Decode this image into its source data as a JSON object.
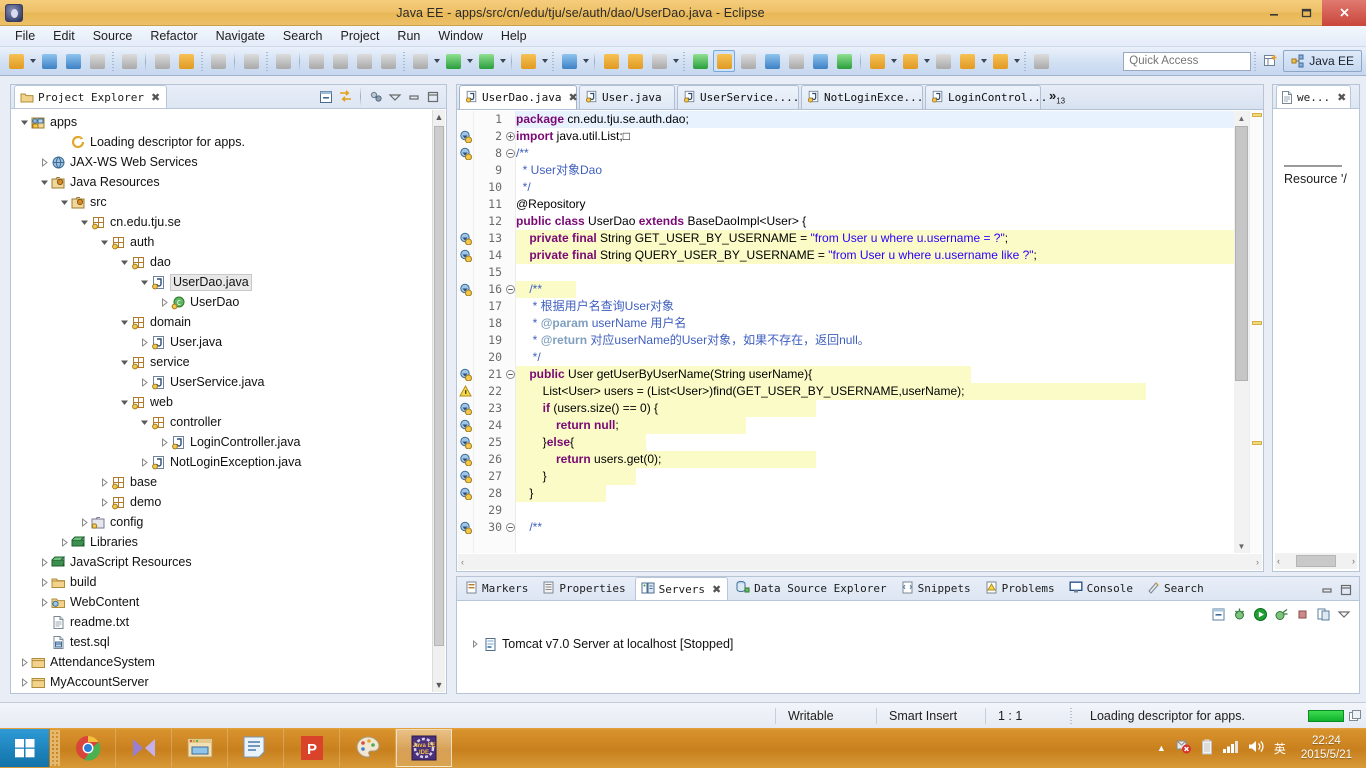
{
  "window": {
    "title": "Java EE - apps/src/cn/edu/tju/se/auth/dao/UserDao.java - Eclipse",
    "app_icon": "eclipse-icon",
    "minimize_label": "–",
    "maximize_label": "❐",
    "close_label": "✕"
  },
  "menubar": {
    "items": [
      "File",
      "Edit",
      "Source",
      "Refactor",
      "Navigate",
      "Search",
      "Project",
      "Run",
      "Window",
      "Help"
    ]
  },
  "toolbar": {
    "groups": [
      {
        "items": [
          {
            "icon": "new-wizard-icon",
            "color": "sq-orange",
            "dropdown": true
          },
          {
            "icon": "save-icon",
            "color": "sq-blue",
            "dropdown": false
          },
          {
            "icon": "save-all-icon",
            "color": "sq-blue",
            "dropdown": false
          },
          {
            "icon": "print-icon",
            "color": "sq-gray",
            "dropdown": false
          }
        ]
      },
      {
        "items": [
          {
            "icon": "toggle-mark-occurrences-icon",
            "color": "sq-gray",
            "dropdown": false
          }
        ]
      },
      {
        "items": [
          {
            "icon": "build-all-icon",
            "color": "sq-gray",
            "dropdown": false
          },
          {
            "icon": "build-project-icon",
            "color": "sq-orange",
            "dropdown": false
          }
        ]
      },
      {
        "items": [
          {
            "icon": "new-java-package-icon",
            "color": "sq-gray",
            "dropdown": false
          }
        ]
      },
      {
        "items": [
          {
            "icon": "undo-icon",
            "color": "sq-gray",
            "dropdown": false
          }
        ]
      },
      {
        "items": [
          {
            "icon": "redo-icon",
            "color": "sq-gray",
            "dropdown": false
          }
        ]
      },
      {
        "items": [
          {
            "icon": "step-into-icon",
            "color": "sq-gray",
            "dropdown": false
          },
          {
            "icon": "suspend-icon",
            "color": "sq-gray",
            "dropdown": false
          },
          {
            "icon": "terminate-icon",
            "color": "sq-gray",
            "dropdown": false
          },
          {
            "icon": "disconnect-icon",
            "color": "sq-gray",
            "dropdown": false
          }
        ]
      },
      {
        "items": [
          {
            "icon": "debug-icon",
            "color": "sq-gray",
            "dropdown": true
          },
          {
            "icon": "run-icon",
            "color": "sq-green",
            "dropdown": true
          },
          {
            "icon": "run-on-server-icon",
            "color": "sq-green",
            "dropdown": true
          }
        ]
      },
      {
        "items": [
          {
            "icon": "new-java-class-icon",
            "color": "sq-orange",
            "dropdown": true
          }
        ]
      },
      {
        "items": [
          {
            "icon": "new-spring-bean-icon",
            "color": "sq-blue",
            "dropdown": true
          }
        ]
      },
      {
        "items": [
          {
            "icon": "open-type-icon",
            "color": "sq-orange",
            "dropdown": false
          },
          {
            "icon": "open-task-icon",
            "color": "sq-orange",
            "dropdown": false
          },
          {
            "icon": "search-icon",
            "color": "sq-gray",
            "dropdown": true
          }
        ]
      },
      {
        "items": [
          {
            "icon": "previous-annotation-icon",
            "color": "sq-green",
            "dropdown": false
          },
          {
            "icon": "toggle-highlight-icon",
            "color": "sq-orange",
            "dropdown": false,
            "active": true
          },
          {
            "icon": "next-annotation-icon",
            "color": "sq-gray",
            "dropdown": false
          },
          {
            "icon": "block-selection-icon",
            "color": "sq-blue",
            "dropdown": false
          },
          {
            "icon": "show-whitespace-icon",
            "color": "sq-gray",
            "dropdown": false
          },
          {
            "icon": "open-web-browser-icon",
            "color": "sq-blue",
            "dropdown": false
          },
          {
            "icon": "external-tools-icon",
            "color": "sq-green",
            "dropdown": false
          }
        ]
      },
      {
        "items": [
          {
            "icon": "previous-edit-location-icon",
            "color": "sq-orange",
            "dropdown": true
          },
          {
            "icon": "next-edit-location-icon",
            "color": "sq-orange",
            "dropdown": true
          },
          {
            "icon": "back-icon",
            "color": "sq-gray",
            "dropdown": false
          },
          {
            "icon": "forward-history-icon",
            "color": "sq-orange",
            "dropdown": true
          },
          {
            "icon": "forward-icon",
            "color": "sq-orange",
            "dropdown": true
          }
        ]
      },
      {
        "items": [
          {
            "icon": "pin-editor-icon",
            "color": "sq-gray",
            "dropdown": false
          }
        ]
      }
    ],
    "quick_access_placeholder": "Quick Access",
    "new-perspective-icon": "open-perspective-icon",
    "perspective_label": "Java EE"
  },
  "project_explorer": {
    "tab_label": "Project Explorer",
    "tab_close": "✖",
    "tools": [
      "collapse-all-icon",
      "link-with-editor-icon",
      "view-menu-icon",
      "minimize-icon",
      "maximize-icon"
    ],
    "tree": [
      {
        "depth": 0,
        "twist": "open",
        "icon": "project-icon",
        "label": "apps"
      },
      {
        "depth": 2,
        "twist": "none",
        "icon": "loading-icon",
        "label": "Loading descriptor for apps."
      },
      {
        "depth": 1,
        "twist": "closed",
        "icon": "jaxws-icon",
        "label": "JAX-WS Web Services"
      },
      {
        "depth": 1,
        "twist": "open",
        "icon": "java-resources-icon",
        "label": "Java Resources"
      },
      {
        "depth": 2,
        "twist": "open",
        "icon": "source-folder-icon",
        "label": "src"
      },
      {
        "depth": 3,
        "twist": "open",
        "icon": "package-icon",
        "label": "cn.edu.tju.se"
      },
      {
        "depth": 4,
        "twist": "open",
        "icon": "package-icon",
        "label": "auth"
      },
      {
        "depth": 5,
        "twist": "open",
        "icon": "package-icon",
        "label": "dao"
      },
      {
        "depth": 6,
        "twist": "open",
        "icon": "java-file-icon",
        "label": "UserDao.java",
        "selected": true
      },
      {
        "depth": 7,
        "twist": "closed",
        "icon": "class-icon",
        "label": "UserDao"
      },
      {
        "depth": 5,
        "twist": "open",
        "icon": "package-icon",
        "label": "domain"
      },
      {
        "depth": 6,
        "twist": "closed",
        "icon": "java-file-icon",
        "label": "User.java"
      },
      {
        "depth": 5,
        "twist": "open",
        "icon": "package-icon",
        "label": "service"
      },
      {
        "depth": 6,
        "twist": "closed",
        "icon": "java-file-icon",
        "label": "UserService.java"
      },
      {
        "depth": 5,
        "twist": "open",
        "icon": "package-icon",
        "label": "web"
      },
      {
        "depth": 6,
        "twist": "open",
        "icon": "package-icon",
        "label": "controller"
      },
      {
        "depth": 7,
        "twist": "closed",
        "icon": "java-file-icon",
        "label": "LoginController.java"
      },
      {
        "depth": 6,
        "twist": "closed",
        "icon": "java-file-icon",
        "label": "NotLoginException.java"
      },
      {
        "depth": 4,
        "twist": "closed",
        "icon": "package-icon",
        "label": "base"
      },
      {
        "depth": 4,
        "twist": "closed",
        "icon": "package-icon",
        "label": "demo"
      },
      {
        "depth": 3,
        "twist": "closed",
        "icon": "config-folder-icon",
        "label": "config"
      },
      {
        "depth": 2,
        "twist": "closed",
        "icon": "library-icon",
        "label": "Libraries"
      },
      {
        "depth": 1,
        "twist": "closed",
        "icon": "library-icon",
        "label": "JavaScript Resources"
      },
      {
        "depth": 1,
        "twist": "closed",
        "icon": "folder-icon",
        "label": "build"
      },
      {
        "depth": 1,
        "twist": "closed",
        "icon": "webcontent-folder-icon",
        "label": "WebContent"
      },
      {
        "depth": 1,
        "twist": "none",
        "icon": "text-file-icon",
        "label": "readme.txt"
      },
      {
        "depth": 1,
        "twist": "none",
        "icon": "sql-file-icon",
        "label": "test.sql"
      },
      {
        "depth": 0,
        "twist": "closed",
        "icon": "closed-project-icon",
        "label": "AttendanceSystem"
      },
      {
        "depth": 0,
        "twist": "closed",
        "icon": "closed-project-icon",
        "label": "MyAccountServer"
      }
    ]
  },
  "editor": {
    "tabs": [
      {
        "label": "UserDao.java",
        "active": true,
        "close": "✖"
      },
      {
        "label": "User.java",
        "active": false
      },
      {
        "label": "UserService....",
        "active": false
      },
      {
        "label": "NotLoginExce...",
        "active": false
      },
      {
        "label": "LoginControl...",
        "active": false
      }
    ],
    "overflow_label": "»",
    "overflow_count": "13",
    "lines": [
      {
        "num": "1",
        "fold": "",
        "marker": "",
        "cur": true,
        "html": "<span class='kw'>package</span> cn.edu.tju.se.auth.dao;"
      },
      {
        "num": "2",
        "fold": "+",
        "marker": "warn",
        "html": "<span class='kw'>import</span> java.util.List;□"
      },
      {
        "num": "8",
        "fold": "-",
        "marker": "warn",
        "html": "<span class='jdoc'>/**</span>"
      },
      {
        "num": "9",
        "fold": "",
        "marker": "",
        "html": "  <span class='jdoc'>* User对象Dao</span>"
      },
      {
        "num": "10",
        "fold": "",
        "marker": "",
        "html": "  <span class='jdoc'>*/</span>"
      },
      {
        "num": "11",
        "fold": "",
        "marker": "",
        "html": "@Repository"
      },
      {
        "num": "12",
        "fold": "",
        "marker": "",
        "html": "<span class='kw'>public</span> <span class='kw'>class</span> UserDao <span class='kw'>extends</span> BaseDaoImpl&lt;User&gt; {"
      },
      {
        "num": "13",
        "fold": "",
        "marker": "warn",
        "hl": true,
        "html": "    <span class='kw'>private</span> <span class='kw'>final</span> String GET_USER_BY_USERNAME = <span class='str'>\"from User u where u.username = ?\"</span>;"
      },
      {
        "num": "14",
        "fold": "",
        "marker": "warn",
        "hl": true,
        "html": "    <span class='kw'>private</span> <span class='kw'>final</span> String QUERY_USER_BY_USERNAME = <span class='str'>\"from User u where u.username like ?\"</span>;"
      },
      {
        "num": "15",
        "fold": "",
        "marker": "",
        "html": ""
      },
      {
        "num": "16",
        "fold": "-",
        "marker": "warn",
        "hl": true,
        "hlw": "60",
        "html": "    <span class='jdoc'>/**</span>"
      },
      {
        "num": "17",
        "fold": "",
        "marker": "",
        "html": "     <span class='jdoc'>* 根据用户名查询User对象</span>"
      },
      {
        "num": "18",
        "fold": "",
        "marker": "",
        "html": "     <span class='jdoc'>* <span class='jtag'>@param</span> userName 用户名</span>"
      },
      {
        "num": "19",
        "fold": "",
        "marker": "",
        "html": "     <span class='jdoc'>* <span class='jtag'>@return</span> 对应userName的User对象，如果不存在，返回null。</span>"
      },
      {
        "num": "20",
        "fold": "",
        "marker": "",
        "html": "     <span class='jdoc'>*/</span>"
      },
      {
        "num": "21",
        "fold": "-",
        "marker": "warn",
        "hl": true,
        "hlw": "455",
        "html": "    <span class='kw'>public</span> User getUserByUserName(String userName){"
      },
      {
        "num": "22",
        "fold": "",
        "marker": "warn2",
        "hl": true,
        "hlw": "630",
        "html": "        List&lt;User&gt; users = (List&lt;User&gt;)find(GET_USER_BY_USERNAME,userName);"
      },
      {
        "num": "23",
        "fold": "",
        "marker": "warn",
        "hl": true,
        "hlw": "300",
        "html": "        <span class='kw'>if</span> (users.size() == 0) {"
      },
      {
        "num": "24",
        "fold": "",
        "marker": "warn",
        "hl": true,
        "hlw": "230",
        "html": "            <span class='kw'>return</span> <span class='kw'>null</span>;"
      },
      {
        "num": "25",
        "fold": "",
        "marker": "warn",
        "hl": true,
        "hlw": "130",
        "html": "        }<span class='kw'>else</span>{"
      },
      {
        "num": "26",
        "fold": "",
        "marker": "warn",
        "hl": true,
        "hlw": "300",
        "html": "            <span class='kw'>return</span> users.get(0);"
      },
      {
        "num": "27",
        "fold": "",
        "marker": "warn",
        "hl": true,
        "hlw": "120",
        "html": "        }"
      },
      {
        "num": "28",
        "fold": "",
        "marker": "warn",
        "hl": true,
        "hlw": "90",
        "html": "    }"
      },
      {
        "num": "29",
        "fold": "",
        "marker": "",
        "html": ""
      },
      {
        "num": "30",
        "fold": "-",
        "marker": "warn",
        "html": "    <span class='jdoc'>/**</span>"
      }
    ],
    "hscroll_left": "‹",
    "hscroll_right": "›"
  },
  "right_view": {
    "tab_label": "we...",
    "tab_close": "✖",
    "content_text": "Resource '/",
    "hscroll_left": "‹",
    "hscroll_right": "›"
  },
  "bottom_panel": {
    "tabs": [
      {
        "label": "Markers",
        "icon": "markers-icon",
        "active": false
      },
      {
        "label": "Properties",
        "icon": "properties-icon",
        "active": false
      },
      {
        "label": "Servers",
        "icon": "servers-icon",
        "active": true,
        "close": "✖"
      },
      {
        "label": "Data Source Explorer",
        "icon": "data-source-icon",
        "active": false
      },
      {
        "label": "Snippets",
        "icon": "snippets-icon",
        "active": false
      },
      {
        "label": "Problems",
        "icon": "problems-icon",
        "active": false
      },
      {
        "label": "Console",
        "icon": "console-icon",
        "active": false
      },
      {
        "label": "Search",
        "icon": "search-view-icon",
        "active": false
      }
    ],
    "view_tools": [
      "minimize-icon",
      "maximize-icon"
    ],
    "toolbar_icons": [
      "new-server-icon",
      "debug-server-icon",
      "start-server-icon",
      "start-profiling-icon",
      "stop-server-icon",
      "publish-icon",
      "view-menu-icon"
    ],
    "server_row": {
      "twist": "closed",
      "icon": "tomcat-server-icon",
      "label": "Tomcat v7.0 Server at localhost  [Stopped]"
    }
  },
  "statusbar": {
    "writable": "Writable",
    "insert_mode": "Smart Insert",
    "position": "1 : 1",
    "message": "Loading descriptor for apps.",
    "progress_icon": "progress-bar",
    "tray_icon": "show-progress-icon"
  },
  "taskbar": {
    "start_label": "start-button",
    "apps": [
      {
        "icon": "chrome-icon",
        "active": false
      },
      {
        "icon": "media-player-icon",
        "active": false
      },
      {
        "icon": "file-explorer-icon",
        "active": false
      },
      {
        "icon": "notes-icon",
        "active": false
      },
      {
        "icon": "powerpoint-icon",
        "active": false
      },
      {
        "icon": "paint-icon",
        "active": false
      },
      {
        "icon": "eclipse-javaee-icon",
        "active": true
      }
    ],
    "tray": {
      "show_hidden": "▲",
      "icons": [
        "network-error-icon",
        "battery-icon",
        "signal-icon",
        "volume-icon"
      ],
      "ime_label": "英",
      "time": "22:24",
      "date": "2015/5/21"
    }
  },
  "colors": {
    "title_bar": "#eec068",
    "taskbar": "#c8801e",
    "accent_blue": "#3d81c4",
    "highlight_yellow": "#fbfbc7",
    "current_line": "#e8f2fe",
    "keyword_purple": "#7a0874",
    "string_blue": "#2a00ff",
    "javadoc_blue": "#3f5fbf",
    "progress_green": "#0fb32b"
  }
}
